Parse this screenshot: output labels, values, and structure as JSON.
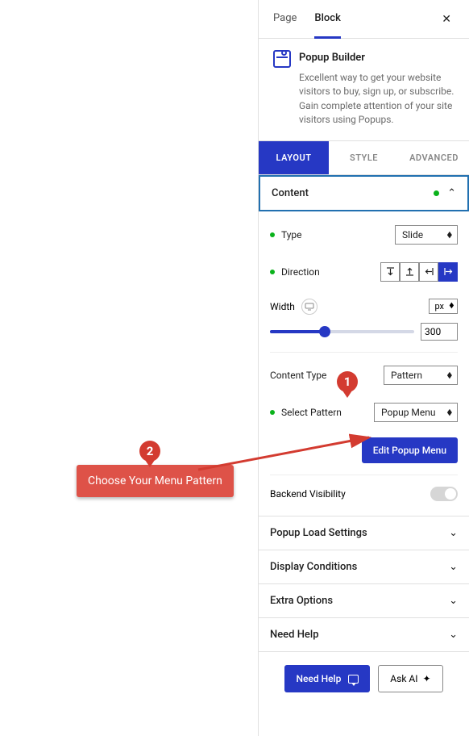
{
  "topTabs": {
    "page": "Page",
    "block": "Block"
  },
  "block": {
    "title": "Popup Builder",
    "desc": "Excellent way to get your website visitors to buy, sign up, or subscribe. Gain complete attention of your site visitors using Popups."
  },
  "subTabs": {
    "layout": "LAYOUT",
    "style": "STYLE",
    "advanced": "ADVANCED"
  },
  "content": {
    "header": "Content",
    "typeLabel": "Type",
    "typeValue": "Slide",
    "dirLabel": "Direction",
    "widthLabel": "Width",
    "widthUnit": "px",
    "widthValue": "300",
    "contentTypeLabel": "Content Type",
    "contentTypeValue": "Pattern",
    "selectPatternLabel": "Select Pattern",
    "selectPatternValue": "Popup Menu",
    "editBtn": "Edit Popup Menu",
    "backendVisLabel": "Backend Visibility"
  },
  "sections": {
    "popupLoad": "Popup Load Settings",
    "display": "Display Conditions",
    "extra": "Extra Options",
    "help": "Need Help"
  },
  "footer": {
    "needHelp": "Need Help",
    "askAi": "Ask AI"
  },
  "markers": {
    "one": "1",
    "two": "2"
  },
  "callout": "Choose Your Menu Pattern"
}
